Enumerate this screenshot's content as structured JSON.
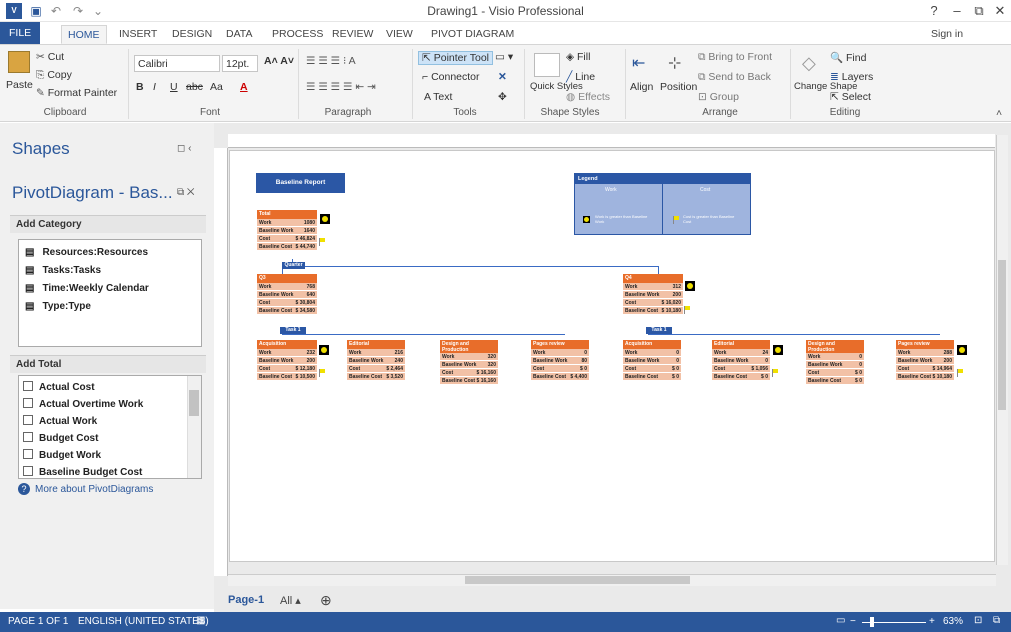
{
  "title": "Drawing1 - Visio Professional",
  "window": {
    "help": "?",
    "minimize": "–",
    "restore": "⧉",
    "close": "✕"
  },
  "tabs": [
    "FILE",
    "HOME",
    "INSERT",
    "DESIGN",
    "DATA",
    "PROCESS",
    "REVIEW",
    "VIEW",
    "PIVOT DIAGRAM"
  ],
  "signin": "Sign in",
  "ribbon": {
    "clipboard": {
      "label": "Clipboard",
      "paste": "Paste",
      "cut": "Cut",
      "copy": "Copy",
      "format_painter": "Format Painter"
    },
    "font": {
      "label": "Font",
      "family": "Calibri",
      "size": "12pt.",
      "bold": "B",
      "italic": "I",
      "underline": "U",
      "strike": "abc",
      "case": "Aa",
      "color": "A"
    },
    "paragraph": {
      "label": "Paragraph"
    },
    "tools": {
      "label": "Tools",
      "pointer": "Pointer Tool",
      "connector": "Connector",
      "text": "A Text"
    },
    "shape_styles": {
      "label": "Shape Styles",
      "quick": "Quick Styles",
      "fill": "Fill",
      "line": "Line",
      "effects": "Effects"
    },
    "arrange": {
      "label": "Arrange",
      "align": "Align",
      "position": "Position",
      "bring_front": "Bring to Front",
      "send_back": "Send to Back",
      "group": "Group"
    },
    "editing": {
      "label": "Editing",
      "change_shape": "Change Shape",
      "find": "Find",
      "layers": "Layers",
      "select": "Select"
    }
  },
  "shapes_pane": {
    "title": "Shapes",
    "sub_title": "PivotDiagram - Bas...",
    "add_category": "Add Category",
    "categories": [
      "Resources:Resources",
      "Tasks:Tasks",
      "Time:Weekly Calendar",
      "Type:Type"
    ],
    "add_total": "Add Total",
    "totals": [
      "Actual Cost",
      "Actual Overtime Work",
      "Actual Work",
      "Budget Cost",
      "Budget Work",
      "Baseline Budget Cost"
    ],
    "help_link": "More about PivotDiagrams"
  },
  "diagram": {
    "report_title": "Baseline Report",
    "legend": {
      "title": "Legend",
      "col1": "Work",
      "col2": "Cost",
      "desc1": "Work is greater than Baseline Work",
      "desc2": "Cost is greater than Baseline Cost"
    },
    "total": {
      "title": "Total",
      "rows": [
        [
          "Work",
          "1080"
        ],
        [
          "Baseline Work",
          "1640"
        ],
        [
          "Cost",
          "$ 46,824"
        ],
        [
          "Baseline Cost",
          "$ 44,740"
        ]
      ]
    },
    "quarter_label": "Quarter",
    "task_label": "Task 1",
    "q3": {
      "title": "Q3",
      "rows": [
        [
          "Work",
          "768"
        ],
        [
          "Baseline Work",
          "640"
        ],
        [
          "Cost",
          "$ 30,804"
        ],
        [
          "Baseline Cost",
          "$ 34,580"
        ]
      ]
    },
    "q4": {
      "title": "Q4",
      "rows": [
        [
          "Work",
          "312"
        ],
        [
          "Baseline Work",
          "200"
        ],
        [
          "Cost",
          "$ 16,020"
        ],
        [
          "Baseline Cost",
          "$ 10,180"
        ]
      ]
    },
    "q3_children": [
      {
        "title": "Acquisition",
        "rows": [
          [
            "Work",
            "232"
          ],
          [
            "Baseline Work",
            "200"
          ],
          [
            "Cost",
            "$ 12,180"
          ],
          [
            "Baseline Cost",
            "$ 10,500"
          ]
        ]
      },
      {
        "title": "Editorial",
        "rows": [
          [
            "Work",
            "216"
          ],
          [
            "Baseline Work",
            "240"
          ],
          [
            "Cost",
            "$ 2,464"
          ],
          [
            "Baseline Cost",
            "$ 3,520"
          ]
        ]
      },
      {
        "title": "Design and Production",
        "rows": [
          [
            "Work",
            "320"
          ],
          [
            "Baseline Work",
            "320"
          ],
          [
            "Cost",
            "$ 16,160"
          ],
          [
            "Baseline Cost",
            "$ 16,160"
          ]
        ]
      },
      {
        "title": "Pages review",
        "rows": [
          [
            "Work",
            "0"
          ],
          [
            "Baseline Work",
            "80"
          ],
          [
            "Cost",
            "$ 0"
          ],
          [
            "Baseline Cost",
            "$ 4,400"
          ]
        ]
      }
    ],
    "q4_children": [
      {
        "title": "Acquisition",
        "rows": [
          [
            "Work",
            "0"
          ],
          [
            "Baseline Work",
            "0"
          ],
          [
            "Cost",
            "$ 0"
          ],
          [
            "Baseline Cost",
            "$ 0"
          ]
        ]
      },
      {
        "title": "Editorial",
        "rows": [
          [
            "Work",
            "24"
          ],
          [
            "Baseline Work",
            "0"
          ],
          [
            "Cost",
            "$ 1,056"
          ],
          [
            "Baseline Cost",
            "$ 0"
          ]
        ]
      },
      {
        "title": "Design and Production",
        "rows": [
          [
            "Work",
            "0"
          ],
          [
            "Baseline Work",
            "0"
          ],
          [
            "Cost",
            "$ 0"
          ],
          [
            "Baseline Cost",
            "$ 0"
          ]
        ]
      },
      {
        "title": "Pages review",
        "rows": [
          [
            "Work",
            "288"
          ],
          [
            "Baseline Work",
            "200"
          ],
          [
            "Cost",
            "$ 14,964"
          ],
          [
            "Baseline Cost",
            "$ 10,180"
          ]
        ]
      }
    ]
  },
  "page_tabs": {
    "page": "Page-1",
    "all": "All ▴",
    "add": "⊕"
  },
  "status": {
    "page": "PAGE 1 OF 1",
    "lang": "ENGLISH (UNITED STATES)",
    "zoom": "63%"
  },
  "colors": {
    "accent": "#2b579a",
    "node_header": "#e86d2a",
    "node_body": "#f2c1a6",
    "legend": "#2b57a5"
  }
}
